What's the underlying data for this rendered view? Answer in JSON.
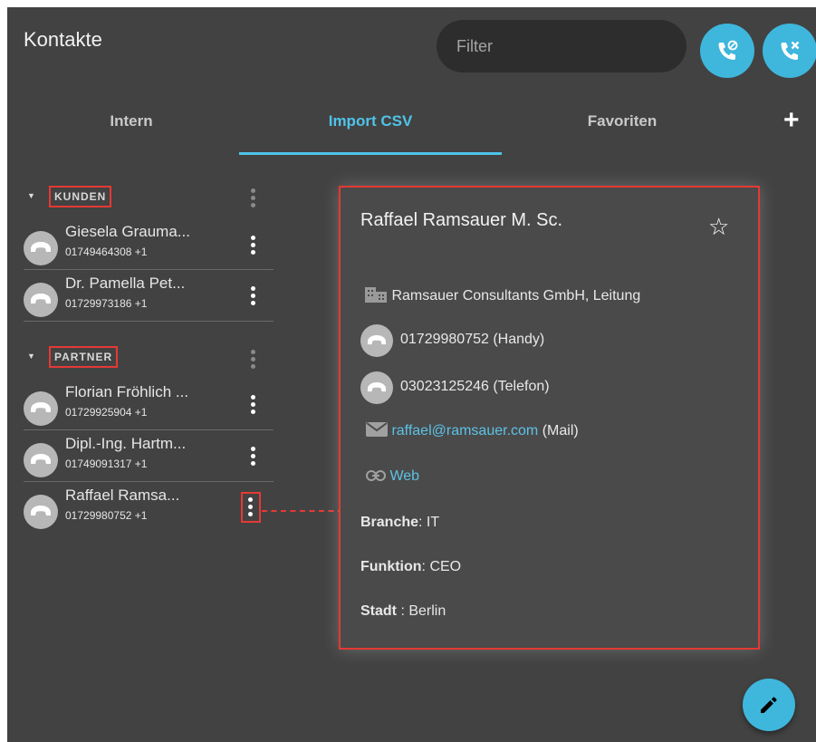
{
  "header": {
    "title": "Kontakte",
    "filter_placeholder": "Filter"
  },
  "tabs": [
    {
      "label": "Intern",
      "active": false
    },
    {
      "label": "Import CSV",
      "active": true
    },
    {
      "label": "Favoriten",
      "active": false
    }
  ],
  "add_label": "+",
  "groups": [
    {
      "label": "KUNDEN",
      "contacts": [
        {
          "name": "Giesela Grauma...",
          "number": "01749464308 +1"
        },
        {
          "name": "Dr. Pamella Pet...",
          "number": "01729973186 +1"
        }
      ]
    },
    {
      "label": "PARTNER",
      "contacts": [
        {
          "name": "Florian Fröhlich ...",
          "number": "01729925904 +1"
        },
        {
          "name": "Dipl.-Ing. Hartm...",
          "number": "01749091317 +1"
        },
        {
          "name": "Raffael Ramsa...",
          "number": "01729980752 +1"
        }
      ]
    }
  ],
  "detail": {
    "name": "Raffael Ramsauer M. Sc.",
    "star": "☆",
    "company": "Ramsauer Consultants GmbH, Leitung",
    "phone1": "01729980752 (Handy)",
    "phone2": "03023125246 (Telefon)",
    "email": "raffael@ramsauer.com",
    "email_type": "(Mail)",
    "web": "Web",
    "branche_label": "Branche",
    "branche_value": ": IT",
    "funktion_label": "Funktion",
    "funktion_value": ": CEO",
    "stadt_label": "Stadt",
    "stadt_value": " : Berlin"
  },
  "icons": {
    "call_blocked": "phone-blocked-icon",
    "call_cancel": "phone-cancel-icon",
    "phone": "phone-icon",
    "building": "building-icon",
    "mail": "mail-icon",
    "link": "link-icon",
    "edit": "pencil-icon"
  },
  "colors": {
    "accent": "#3fb6dc",
    "tab_active": "#4fc3e8",
    "highlight": "#e53935",
    "background": "#424242"
  }
}
